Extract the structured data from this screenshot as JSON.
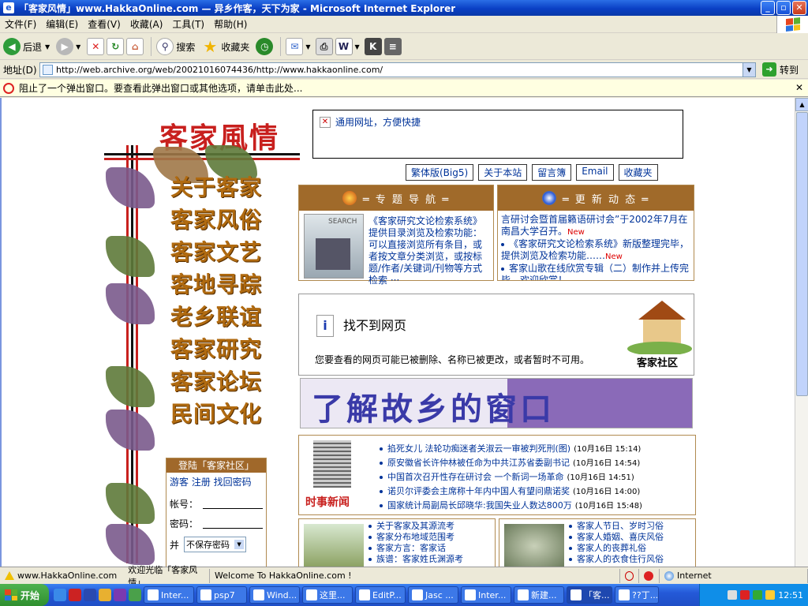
{
  "window": {
    "title": "「客家风情」www.HakkaOnline.com — 异乡作客，天下为家 - Microsoft Internet Explorer"
  },
  "menu": [
    "文件(F)",
    "编辑(E)",
    "查看(V)",
    "收藏(A)",
    "工具(T)",
    "帮助(H)"
  ],
  "toolbar": {
    "back": "后退",
    "search": "搜索",
    "favorites": "收藏夹"
  },
  "address": {
    "label": "地址(D)",
    "url": "http://web.archive.org/web/20021016074436/http://www.hakkaonline.com/",
    "go": "转到"
  },
  "popup_notice": "阻止了一个弹出窗口。要查看此弹出窗口或其他选项，请单击此处...",
  "page": {
    "logo": "客家風情",
    "nav": [
      "关于客家",
      "客家风俗",
      "客家文艺",
      "客地寻踪",
      "老乡联谊",
      "客家研究",
      "客家论坛",
      "民间文化"
    ],
    "login": {
      "title": "登陆「客家社区」",
      "links": "游客 注册 找回密码",
      "account": "帐号：",
      "password": "密码：",
      "remember_prefix": "并",
      "remember_option": "不保存密码"
    },
    "topbox": "通用网址，方便快捷",
    "tabs": [
      "繁体版(Big5)",
      "关于本站",
      "留言簿",
      "Email",
      "收藏夹"
    ],
    "guide": {
      "title": "═ 专 题 导 航 ═",
      "search_img": "SEARCH",
      "text": "《客家研究文论检索系统》提供目录浏览及检索功能：可以直接浏览所有条目，或者按文章分类浏览，或按标题/作者/关键词/刊物等方式检索 ···"
    },
    "updates": {
      "title": "═ 更 新 动 态 ═",
      "items": [
        {
          "text": "言研讨会暨首届籁语研讨会”于2002年7月在南昌大学召开。",
          "new": "New"
        },
        {
          "text": "《客家研究文论检索系统》新版整理完毕，提供浏览及检索功能……",
          "new": "New"
        },
        {
          "text": "客家山歌在线欣赏专辑（二）制作并上传完毕，欢迎欣赏！",
          "new": ""
        }
      ]
    },
    "notfound": {
      "title": "找不到网页",
      "desc": "您要查看的网页可能已被删除、名称已被更改，或者暂时不可用。",
      "community": "客家社区"
    },
    "banner": "了解故乡的窗口",
    "news": {
      "label": "时事新闻",
      "items": [
        {
          "title": "掐死女儿 法轮功痴迷者关淑云一审被判死刑(图)",
          "time": "(10月16日 15:14)"
        },
        {
          "title": "原安徽省长许仲林被任命为中共江苏省委副书记",
          "time": "(10月16日 14:54)"
        },
        {
          "title": "中国首次召开性存在研讨会 一个新词一场革命",
          "time": "(10月16日 14:51)"
        },
        {
          "title": "诺贝尔评委会主席称十年内中国人有望问鼎诺奖",
          "time": "(10月16日 14:00)"
        },
        {
          "title": "国家统计局副局长邱晓华:我国失业人数达800万",
          "time": "(10月16日 15:48)"
        }
      ]
    },
    "lower_left": [
      "关于客家及其源流考",
      "客家分布地域范围考",
      "客家方言：客家话",
      "族谱：客家姓氏渊源考"
    ],
    "lower_right": [
      "客家人节日、岁时习俗",
      "客家人婚姻、喜庆风俗",
      "客家人的丧葬礼俗",
      "客家人的衣食住行风俗"
    ]
  },
  "status": {
    "url": "www.HakkaOnline.com",
    "welcome": "欢迎光临「客家风情」",
    "welcome_en": "Welcome To HakkaOnline.com !",
    "zone": "Internet"
  },
  "taskbar": {
    "start": "开始",
    "tasks": [
      "Inter...",
      "psp7",
      "Wind...",
      "这里...",
      "EditP...",
      "Jasc ...",
      "Inter...",
      "新建...",
      "「客...",
      "??丁..."
    ],
    "clock": "12:51"
  },
  "colors": {
    "title_blue": "#0a3fc4",
    "brown": "#a06a2a",
    "link_blue": "#003399",
    "logo_red": "#c8201e"
  }
}
